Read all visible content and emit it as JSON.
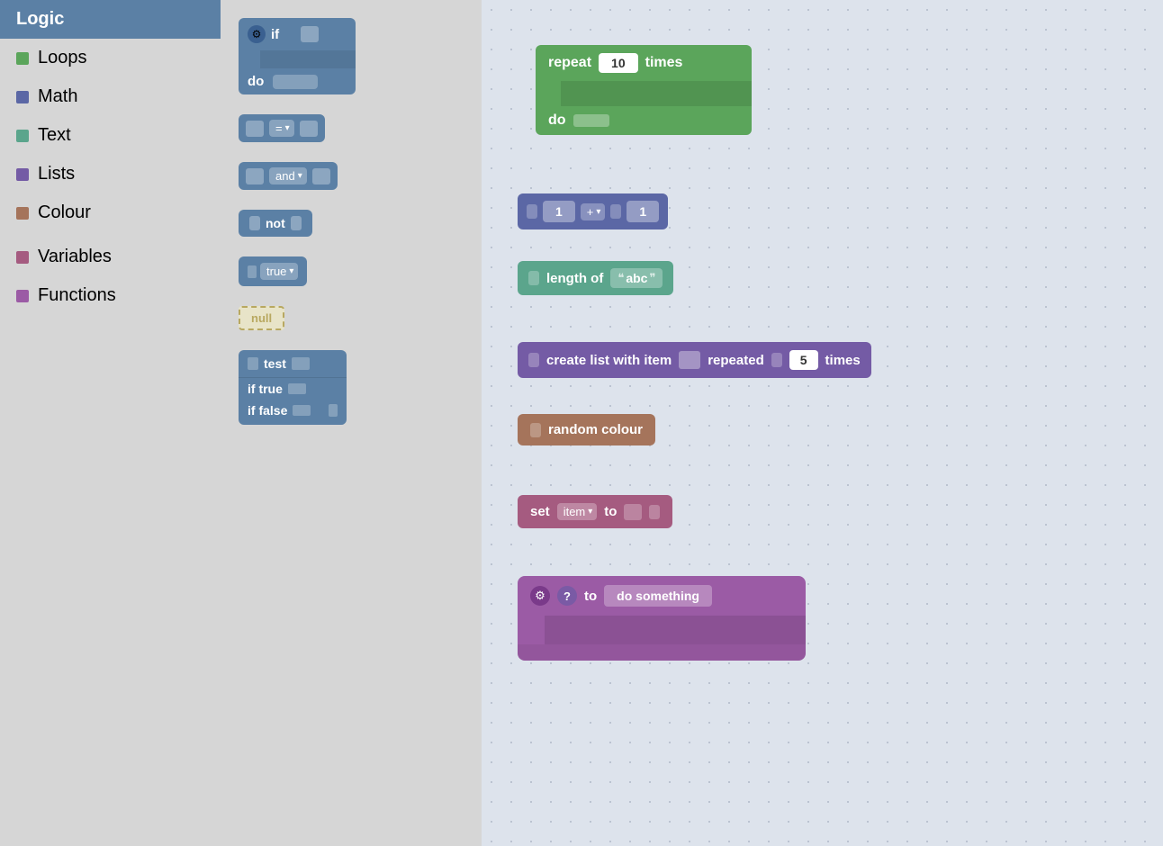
{
  "sidebar": {
    "categories": [
      {
        "id": "logic",
        "label": "Logic",
        "color": "#5b80a5",
        "active": true
      },
      {
        "id": "loops",
        "label": "Loops",
        "color": "#5ba55b"
      },
      {
        "id": "math",
        "label": "Math",
        "color": "#5b67a5"
      },
      {
        "id": "text",
        "label": "Text",
        "color": "#5ba58c"
      },
      {
        "id": "lists",
        "label": "Lists",
        "color": "#745ba5"
      },
      {
        "id": "colour",
        "label": "Colour",
        "color": "#a5745b"
      },
      {
        "id": "variables",
        "label": "Variables",
        "color": "#a55b80"
      },
      {
        "id": "functions",
        "label": "Functions",
        "color": "#9b5ba5"
      }
    ]
  },
  "blocks_panel": {
    "if_label": "if",
    "do_label": "do",
    "eq_label": "=",
    "and_label": "and",
    "not_label": "not",
    "true_label": "true",
    "null_label": "null",
    "test_label": "test",
    "if_true_label": "if true",
    "if_false_label": "if false"
  },
  "canvas_blocks": {
    "repeat_times": "10",
    "repeat_label": "repeat",
    "times_label": "times",
    "do_label": "do",
    "math_a": "1",
    "math_op": "+",
    "math_b": "1",
    "length_of_label": "length of",
    "abc_label": "abc",
    "create_list_label": "create list with item",
    "repeated_label": "repeated",
    "list_times": "5",
    "times2_label": "times",
    "random_colour_label": "random colour",
    "set_label": "set",
    "item_label": "item",
    "to_label": "to",
    "to2_label": "to",
    "do_something_label": "do something"
  }
}
